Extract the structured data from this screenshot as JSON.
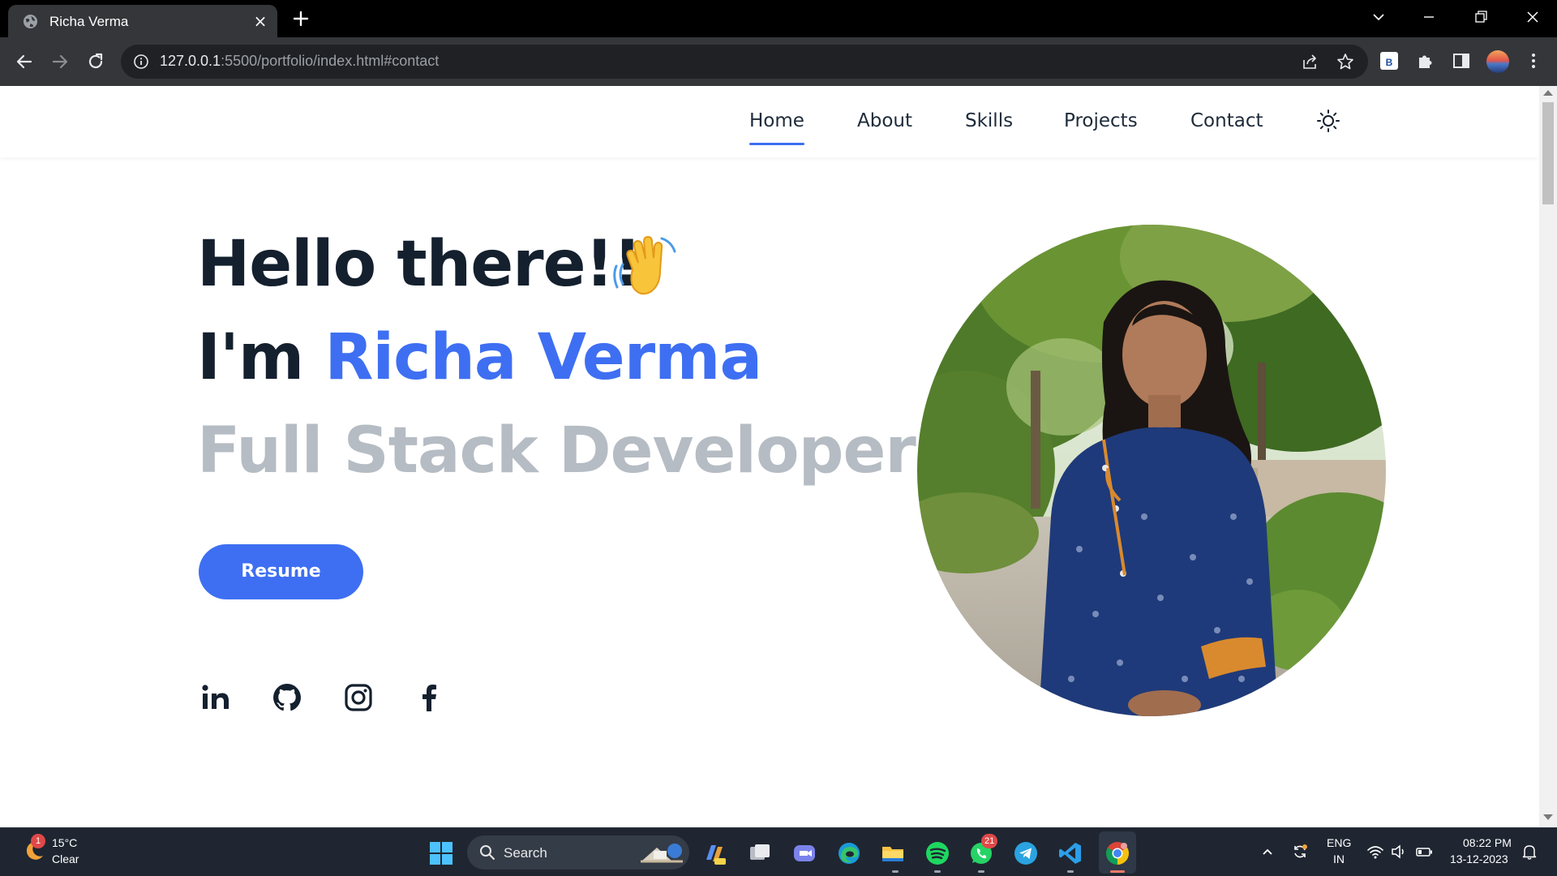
{
  "browser": {
    "tab_title": "Richa Verma",
    "url_host": "127.0.0.1",
    "url_rest": ":5500/portfolio/index.html#contact",
    "extension_label": "B"
  },
  "site": {
    "nav": {
      "items": [
        {
          "label": "Home",
          "active": true
        },
        {
          "label": "About",
          "active": false
        },
        {
          "label": "Skills",
          "active": false
        },
        {
          "label": "Projects",
          "active": false
        },
        {
          "label": "Contact",
          "active": false
        }
      ]
    },
    "hero": {
      "greeting": "Hello there!!",
      "intro_prefix": "I'm ",
      "name": "Richa Verma",
      "role": "Full Stack Developer",
      "resume_label": "Resume"
    },
    "social_icons": [
      "linkedin-icon",
      "github-icon",
      "instagram-icon",
      "facebook-icon"
    ],
    "colors": {
      "accent": "#3e6ff2",
      "heading": "#14202e",
      "role_text": "#b5bcc3"
    }
  },
  "taskbar": {
    "weather_badge": "1",
    "temperature": "15°C",
    "condition": "Clear",
    "search_placeholder": "Search",
    "whatsapp_badge": "21",
    "lang_line1": "ENG",
    "lang_line2": "IN",
    "time": "08:22 PM",
    "date": "13-12-2023"
  }
}
